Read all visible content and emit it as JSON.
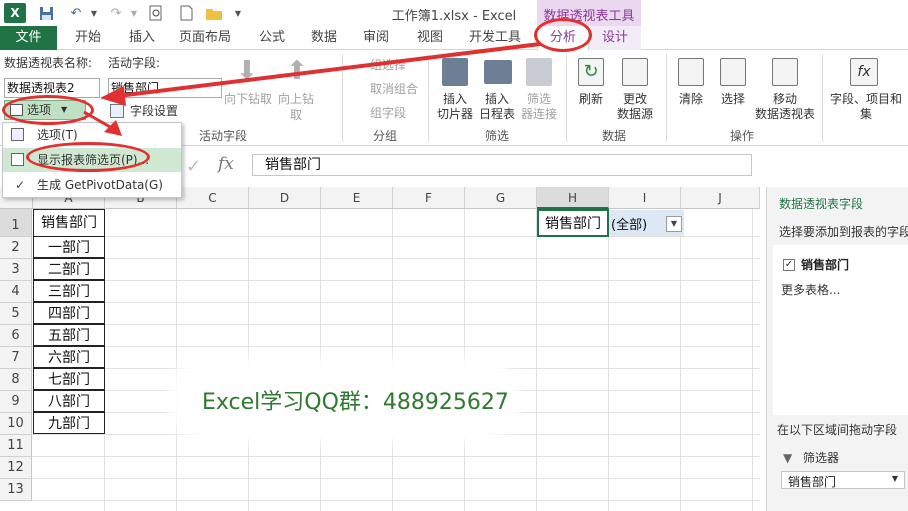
{
  "titlebar": {
    "title": "工作簿1.xlsx - Excel",
    "context_tab": "数据透视表工具"
  },
  "tabs": [
    "文件",
    "开始",
    "插入",
    "页面布局",
    "公式",
    "数据",
    "审阅",
    "视图",
    "开发工具",
    "分析",
    "设计"
  ],
  "ribbon": {
    "pivot_name_label": "数据透视表名称:",
    "pivot_name_value": "数据透视表2",
    "options_button": "选项",
    "active_field_label": "活动字段:",
    "active_field_value": "销售部门",
    "field_settings": "字段设置",
    "drill_down": "向下钻取",
    "drill_up": "向上钻",
    "drill_up_sub": "取",
    "active_field_group": "活动字段",
    "group_selection": "组选择",
    "ungroup": "取消组合",
    "group_field": "组字段",
    "group_group": "分组",
    "insert_slicer_1": "插入",
    "insert_slicer_2": "切片器",
    "insert_timeline_1": "插入",
    "insert_timeline_2": "日程表",
    "filter_connections_1": "筛选",
    "filter_connections_2": "器连接",
    "filter_group": "筛选",
    "refresh": "刷新",
    "change_source_1": "更改",
    "change_source_2": "数据源",
    "data_group": "数据",
    "clear": "清除",
    "select": "选择",
    "move_pivot_1": "移动",
    "move_pivot_2": "数据透视表",
    "actions_group": "操作",
    "fields_items_1": "字段、项目和",
    "fields_items_2": "集"
  },
  "menu": {
    "items": [
      {
        "label": "选项(T)"
      },
      {
        "label": "显示报表筛选页(P)..."
      },
      {
        "label": "生成 GetPivotData(G)"
      }
    ]
  },
  "formula": {
    "cell_ref": "",
    "fx": "fx",
    "content": "销售部门"
  },
  "grid": {
    "columns": [
      "A",
      "B",
      "C",
      "D",
      "E",
      "F",
      "G",
      "H",
      "I",
      "J"
    ],
    "rows": [
      "1",
      "2",
      "3",
      "4",
      "5",
      "6",
      "7",
      "8",
      "9",
      "10",
      "11",
      "12",
      "13"
    ],
    "a_column": [
      "销售部门",
      "一部门",
      "二部门",
      "三部门",
      "四部门",
      "五部门",
      "六部门",
      "七部门",
      "八部门",
      "九部门"
    ],
    "h1": "销售部门",
    "i1": "(全部)"
  },
  "pane": {
    "title": "数据透视表字段",
    "subtitle": "选择要添加到报表的字段",
    "field": "销售部门",
    "more_tables": "更多表格...",
    "drag_hint": "在以下区域间拖动字段",
    "filters_label": "筛选器",
    "filter_value": "销售部门"
  },
  "watermark": "Excel学习QQ群：488925627",
  "colors": {
    "excel_green": "#217346",
    "context_purple": "#8b3a9a",
    "annotation_red": "#e03030"
  }
}
